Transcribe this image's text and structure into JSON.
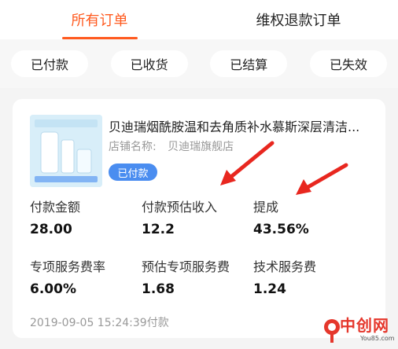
{
  "tabs": [
    {
      "label": "所有订单",
      "active": true
    },
    {
      "label": "维权退款订单",
      "active": false
    }
  ],
  "filters": [
    "已付款",
    "已收货",
    "已结算",
    "已失效"
  ],
  "order": {
    "title": "贝迪瑞烟酰胺温和去角质补水慕斯深层清洁...",
    "shop_label": "店铺名称:",
    "shop_name": "贝迪瑞旗舰店",
    "status": "已付款",
    "metrics": [
      {
        "label": "付款金额",
        "value": "28.00"
      },
      {
        "label": "付款预估收入",
        "value": "12.2"
      },
      {
        "label": "提成",
        "value": "43.56%"
      },
      {
        "label": "专项服务费率",
        "value": "6.00%"
      },
      {
        "label": "预估专项服务费",
        "value": "1.68"
      },
      {
        "label": "技术服务费",
        "value": "1.24"
      }
    ],
    "timestamp": "2019-09-05 15:24:39付款"
  },
  "watermark": {
    "text": "中创网",
    "sub": "You85.com"
  },
  "colors": {
    "accent": "#ff5a1f",
    "badge": "#4a8df0",
    "arrow": "#e8271f"
  }
}
